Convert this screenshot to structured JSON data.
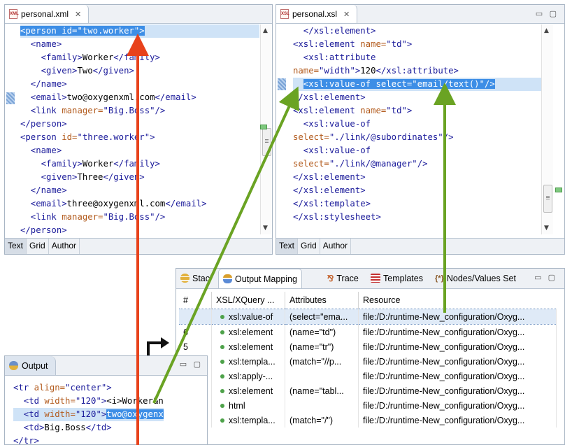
{
  "xml_editor": {
    "tab_title": "personal.xml",
    "bottom_tabs": [
      "Text",
      "Grid",
      "Author"
    ],
    "lines": [
      [
        {
          "t": "s",
          "v": "<person "
        },
        {
          "t": "a",
          "v": "id="
        },
        {
          "t": "v",
          "v": "\"two.worker\""
        },
        {
          "t": "s",
          "v": ">"
        }
      ],
      [
        {
          "t": "s",
          "v": "  <name>"
        }
      ],
      [
        {
          "t": "s",
          "v": "    <family>"
        },
        {
          "t": "x",
          "v": "Worker"
        },
        {
          "t": "s",
          "v": "</family>"
        }
      ],
      [
        {
          "t": "s",
          "v": "    <given>"
        },
        {
          "t": "x",
          "v": "Two"
        },
        {
          "t": "s",
          "v": "</given>"
        }
      ],
      [
        {
          "t": "s",
          "v": "  </name>"
        }
      ],
      [
        {
          "t": "s",
          "v": "  <email>"
        },
        {
          "t": "x",
          "v": "two@oxygenxml.com"
        },
        {
          "t": "s",
          "v": "</email>"
        }
      ],
      [
        {
          "t": "s",
          "v": "  <link "
        },
        {
          "t": "a",
          "v": "manager="
        },
        {
          "t": "v",
          "v": "\"Big.Boss\""
        },
        {
          "t": "s",
          "v": "/>"
        }
      ],
      [
        {
          "t": "s",
          "v": "</person>"
        }
      ],
      [
        {
          "t": "s",
          "v": "<person "
        },
        {
          "t": "a",
          "v": "id="
        },
        {
          "t": "v",
          "v": "\"three.worker\""
        },
        {
          "t": "s",
          "v": ">"
        }
      ],
      [
        {
          "t": "s",
          "v": "  <name>"
        }
      ],
      [
        {
          "t": "s",
          "v": "    <family>"
        },
        {
          "t": "x",
          "v": "Worker"
        },
        {
          "t": "s",
          "v": "</family>"
        }
      ],
      [
        {
          "t": "s",
          "v": "    <given>"
        },
        {
          "t": "x",
          "v": "Three"
        },
        {
          "t": "s",
          "v": "</given>"
        }
      ],
      [
        {
          "t": "s",
          "v": "  </name>"
        }
      ],
      [
        {
          "t": "s",
          "v": "  <email>"
        },
        {
          "t": "x",
          "v": "three@oxygenxml.com"
        },
        {
          "t": "s",
          "v": "</email>"
        }
      ],
      [
        {
          "t": "s",
          "v": "  <link "
        },
        {
          "t": "a",
          "v": "manager="
        },
        {
          "t": "v",
          "v": "\"Big.Boss\""
        },
        {
          "t": "s",
          "v": "/>"
        }
      ],
      [
        {
          "t": "s",
          "v": "</person>"
        }
      ]
    ]
  },
  "xsl_editor": {
    "tab_title": "personal.xsl",
    "bottom_tabs": [
      "Text",
      "Grid",
      "Author"
    ],
    "lines": [
      [
        {
          "t": "s",
          "v": "  </xsl:element>"
        }
      ],
      [
        {
          "t": "s",
          "v": "<xsl:element "
        },
        {
          "t": "a",
          "v": "name="
        },
        {
          "t": "v",
          "v": "\"td\""
        },
        {
          "t": "s",
          "v": ">"
        }
      ],
      [
        {
          "t": "s",
          "v": "  <xsl:attribute"
        }
      ],
      [
        {
          "t": "a",
          "v": "name="
        },
        {
          "t": "v",
          "v": "\"width\""
        },
        {
          "t": "s",
          "v": ">"
        },
        {
          "t": "x",
          "v": "120"
        },
        {
          "t": "s",
          "v": "</xsl:attribute>"
        }
      ],
      [
        {
          "t": "x",
          "v": "  "
        },
        {
          "t": "sel",
          "v": "<xsl:value-of select=\"email/text()\"/>"
        }
      ],
      [
        {
          "t": "s",
          "v": "</xsl:element>"
        }
      ],
      [
        {
          "t": "s",
          "v": "<xsl:element "
        },
        {
          "t": "a",
          "v": "name="
        },
        {
          "t": "v",
          "v": "\"td\""
        },
        {
          "t": "s",
          "v": ">"
        }
      ],
      [
        {
          "t": "s",
          "v": "  <xsl:value-of"
        }
      ],
      [
        {
          "t": "a",
          "v": "select="
        },
        {
          "t": "v",
          "v": "\"./link/@subordinates\""
        },
        {
          "t": "s",
          "v": "/>"
        }
      ],
      [
        {
          "t": "s",
          "v": "  <xsl:value-of"
        }
      ],
      [
        {
          "t": "a",
          "v": "select="
        },
        {
          "t": "v",
          "v": "\"./link/@manager\""
        },
        {
          "t": "s",
          "v": "/>"
        }
      ],
      [
        {
          "t": "s",
          "v": "</xsl:element>"
        }
      ],
      [
        {
          "t": "s",
          "v": "</xsl:element>"
        }
      ],
      [
        {
          "t": "s",
          "v": "</xsl:template>"
        }
      ],
      [
        {
          "t": "s",
          "v": "</xsl:stylesheet>"
        }
      ]
    ]
  },
  "debugger": {
    "tabs": [
      "Stack",
      "Output Mapping",
      "Trace",
      "Templates",
      "Nodes/Values Set"
    ],
    "columns": [
      "#",
      "XSL/XQuery ...",
      "Attributes",
      "Resource"
    ],
    "rows": [
      {
        "num": "",
        "node": "xsl:value-of",
        "attrs": "(select=\"ema...",
        "resource": "file:/D:/runtime-New_configuration/Oxyg..."
      },
      {
        "num": "6",
        "node": "xsl:element",
        "attrs": "(name=\"td\")",
        "resource": "file:/D:/runtime-New_configuration/Oxyg..."
      },
      {
        "num": "5",
        "node": "xsl:element",
        "attrs": "(name=\"tr\")",
        "resource": "file:/D:/runtime-New_configuration/Oxyg..."
      },
      {
        "num": "",
        "node": "xsl:templa...",
        "attrs": "(match=\"//p...",
        "resource": "file:/D:/runtime-New_configuration/Oxyg..."
      },
      {
        "num": "",
        "node": "xsl:apply-...",
        "attrs": "",
        "resource": "file:/D:/runtime-New_configuration/Oxyg..."
      },
      {
        "num": "",
        "node": "xsl:element",
        "attrs": "(name=\"tabl...",
        "resource": "file:/D:/runtime-New_configuration/Oxyg..."
      },
      {
        "num": "",
        "node": "html",
        "attrs": "",
        "resource": "file:/D:/runtime-New_configuration/Oxyg..."
      },
      {
        "num": "",
        "node": "xsl:templa...",
        "attrs": "(match=\"/\")",
        "resource": "file:/D:/runtime-New_configuration/Oxyg..."
      }
    ]
  },
  "output_view": {
    "title": "Output",
    "lines": [
      [
        {
          "t": "s",
          "v": "<tr "
        },
        {
          "t": "a",
          "v": "align="
        },
        {
          "t": "v",
          "v": "\"center\""
        },
        {
          "t": "s",
          "v": ">"
        }
      ],
      [
        {
          "t": "s",
          "v": "  <td "
        },
        {
          "t": "a",
          "v": "width="
        },
        {
          "t": "v",
          "v": "\"120\""
        },
        {
          "t": "s",
          "v": ">"
        },
        {
          "t": "x",
          "v": "<i>Worker&n"
        }
      ],
      [
        {
          "t": "s",
          "v": "  <td "
        },
        {
          "t": "a",
          "v": "width="
        },
        {
          "t": "v",
          "v": "\"120\""
        },
        {
          "t": "s",
          "v": ">"
        },
        {
          "t": "sel",
          "v": "two@oxygenx"
        }
      ],
      [
        {
          "t": "s",
          "v": "  <td>"
        },
        {
          "t": "x",
          "v": "Big.Boss"
        },
        {
          "t": "s",
          "v": "</td>"
        }
      ],
      [
        {
          "t": "s",
          "v": "</tr>"
        }
      ]
    ]
  },
  "colors": {
    "red_arrow": "#e8421b",
    "green_arrow": "#6aa323",
    "selection": "#3d8ee6",
    "tag": "#1a1a9a",
    "attribute": "#b25a1c"
  }
}
